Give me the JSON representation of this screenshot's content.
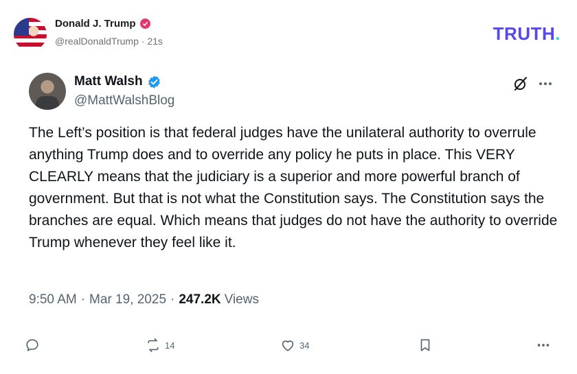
{
  "truth_header": {
    "name": "Donald J. Trump",
    "handle": "@realDonaldTrump",
    "separator": "·",
    "time_ago": "21s",
    "logo_text": "TRUTH",
    "logo_dot": ".",
    "verified_color": "#e5386b",
    "logo_color": "#5448ee",
    "logo_dot_color": "#3ad6c4"
  },
  "x_post": {
    "author_name": "Matt Walsh",
    "author_handle": "@MattWalshBlog",
    "verified_color": "#1d9bf0",
    "text": "The Left’s position is that federal judges have the unilateral authority to overrule anything Trump does and to override any policy he puts in place. This VERY CLEARLY means that the judiciary is a superior and more powerful branch of government. But that is not what the Constitution says. The Constitution says the branches are equal. Which means that judges do not have the authority to override Trump whenever they feel like it.",
    "time": "9:50 AM",
    "date": "Mar 19, 2025",
    "separator": "·",
    "views_count": "247.2K",
    "views_label": "Views",
    "icons": {
      "grok": "grok-icon",
      "more": "more-icon"
    },
    "actions": {
      "reply_count": "",
      "repost_count": "14",
      "like_count": "34"
    }
  }
}
